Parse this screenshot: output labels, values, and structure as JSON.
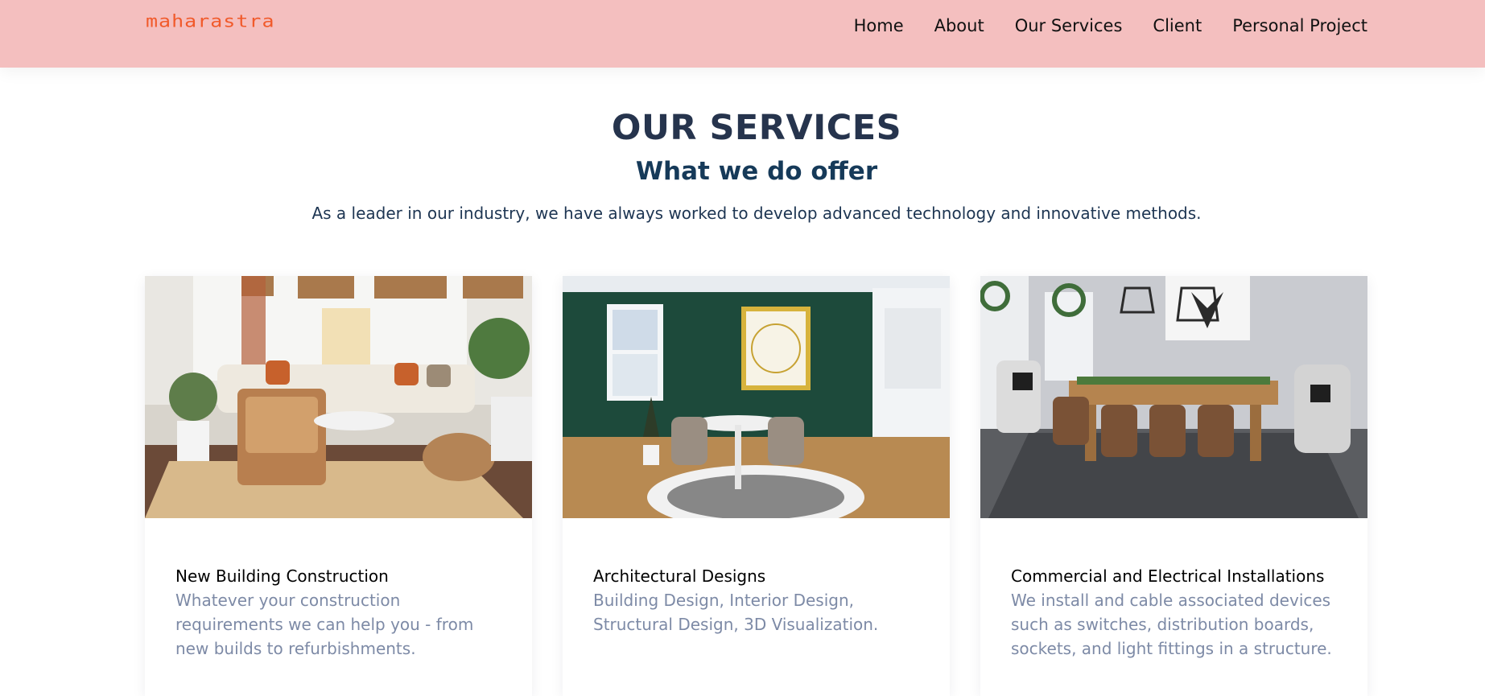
{
  "brand": {
    "logo_text": "MAHARASTRA",
    "color": "#f15a2b"
  },
  "nav": {
    "items": [
      "Home",
      "About",
      "Our Services",
      "Client",
      "Personal Project"
    ]
  },
  "section": {
    "title": "OUR SERVICES",
    "subtitle": "What we do offer",
    "intro": "As a leader in our industry, we have always worked to develop advanced technology and innovative methods."
  },
  "cards": [
    {
      "title": "New Building Construction",
      "text": "Whatever your construction requirements we can help you - from new builds to refurbishments.",
      "image": "living-room-photo"
    },
    {
      "title": "Architectural Designs",
      "text": "Building Design, Interior Design, Structural Design, 3D Visualization.",
      "image": "dining-nook-photo"
    },
    {
      "title": "Commercial and Electrical Installations",
      "text": "We install and cable associated devices such as switches, distribution boards, sockets, and light fittings in a structure.",
      "image": "dining-room-photo"
    }
  ],
  "colors": {
    "navbar_bg": "#f4bfbf",
    "heading": "#26344d",
    "subheading": "#163a59",
    "body_text": "#7d8aa6"
  }
}
